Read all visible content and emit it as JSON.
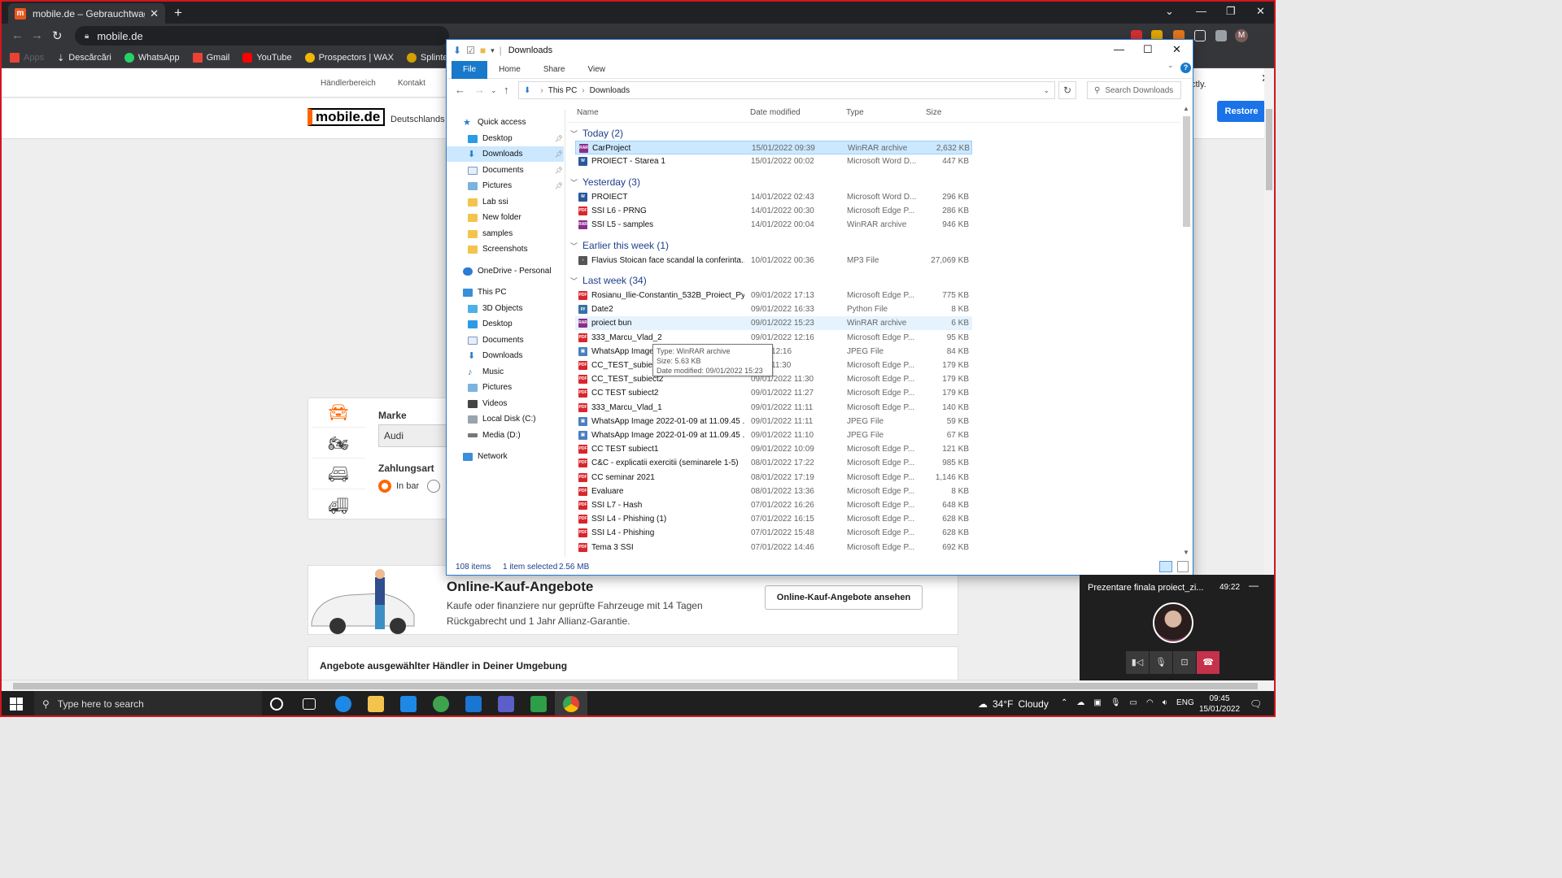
{
  "chrome": {
    "tab_title": "mobile.de – Gebrauchtwagen und",
    "url": "mobile.de",
    "bookmarks": [
      {
        "label": "Apps",
        "color": "#888888"
      },
      {
        "label": "Descărcări",
        "color": "#aaaaaa"
      },
      {
        "label": "WhatsApp",
        "color": "#25d366"
      },
      {
        "label": "Gmail",
        "color": "#ea4335"
      },
      {
        "label": "YouTube",
        "color": "#ff0000"
      },
      {
        "label": "Prospectors | WAX",
        "color": "#f2b705"
      },
      {
        "label": "Splinterlands",
        "color": "#d1a000"
      }
    ]
  },
  "site": {
    "nav": {
      "dealer_area": "Händlerbereich",
      "contact": "Kontakt"
    },
    "logo": "mobile.de",
    "tagline": "Deutschlands",
    "restore_text": "ctly.",
    "restore_button": "Restore",
    "search": {
      "brand_label": "Marke",
      "brand_value": "Audi",
      "payment_label": "Zahlungsart",
      "payment_cash": "In bar",
      "vehicle_icons": [
        "car-icon",
        "motorbike-icon",
        "camper-icon",
        "truck-icon"
      ]
    },
    "online": {
      "title": "Online-Kauf-Angebote",
      "description": "Kaufe oder finanziere nur geprüfte Fahrzeuge mit 14 Tagen Rückgabrecht und 1 Jahr Allianz-Garantie.",
      "button": "Online-Kauf-Angebote ansehen"
    },
    "dealers_title": "Angebote ausgewählter Händler in Deiner Umgebung"
  },
  "explorer": {
    "title": "Downloads",
    "ribbon_tabs": [
      "File",
      "Home",
      "Share",
      "View"
    ],
    "breadcrumb": [
      "This PC",
      "Downloads"
    ],
    "search_placeholder": "Search Downloads",
    "nav": {
      "quick_access": "Quick access",
      "quick_items": [
        "Desktop",
        "Downloads",
        "Documents",
        "Pictures",
        "Lab ssi",
        "New folder",
        "samples",
        "Screenshots"
      ],
      "onedrive": "OneDrive - Personal",
      "this_pc": "This PC",
      "pc_items": [
        "3D Objects",
        "Desktop",
        "Documents",
        "Downloads",
        "Music",
        "Pictures",
        "Videos",
        "Local Disk (C:)",
        "Media (D:)"
      ],
      "network": "Network"
    },
    "columns": {
      "name": "Name",
      "date": "Date modified",
      "type": "Type",
      "size": "Size"
    },
    "groups": [
      {
        "label": "Today (2)",
        "files": [
          {
            "name": "CarProject",
            "date": "15/01/2022 09:39",
            "type": "WinRAR archive",
            "size": "2,632 KB",
            "icon": "rar"
          },
          {
            "name": "PROIECT - Starea 1",
            "date": "15/01/2022 00:02",
            "type": "Microsoft Word D...",
            "size": "447 KB",
            "icon": "word"
          }
        ]
      },
      {
        "label": "Yesterday (3)",
        "files": [
          {
            "name": "PROIECT",
            "date": "14/01/2022 02:43",
            "type": "Microsoft Word D...",
            "size": "296 KB",
            "icon": "word"
          },
          {
            "name": "SSI L6 - PRNG",
            "date": "14/01/2022 00:30",
            "type": "Microsoft Edge P...",
            "size": "286 KB",
            "icon": "pdf"
          },
          {
            "name": "SSI L5 - samples",
            "date": "14/01/2022 00:04",
            "type": "WinRAR archive",
            "size": "946 KB",
            "icon": "rar"
          }
        ]
      },
      {
        "label": "Earlier this week (1)",
        "files": [
          {
            "name": "Flavius Stoican face scandal la conferinta...",
            "date": "10/01/2022 00:36",
            "type": "MP3 File",
            "size": "27,069 KB",
            "icon": "mp3"
          }
        ]
      },
      {
        "label": "Last week (34)",
        "files": [
          {
            "name": "Rosianu_Ilie-Constantin_532B_Proiect_Py...",
            "date": "09/01/2022 17:13",
            "type": "Microsoft Edge P...",
            "size": "775 KB",
            "icon": "pdf"
          },
          {
            "name": "Date2",
            "date": "09/01/2022 16:33",
            "type": "Python File",
            "size": "8 KB",
            "icon": "py"
          },
          {
            "name": "proiect bun",
            "date": "09/01/2022 15:23",
            "type": "WinRAR archive",
            "size": "6 KB",
            "icon": "rar"
          },
          {
            "name": "333_Marcu_Vlad_2",
            "date": "09/01/2022 12:16",
            "type": "Microsoft Edge P...",
            "size": "95 KB",
            "icon": "pdf"
          },
          {
            "name": "WhatsApp Image",
            "date": "2022 12:16",
            "type": "JPEG File",
            "size": "84 KB",
            "icon": "jpg"
          },
          {
            "name": "CC_TEST_subiect2",
            "date": "2022 11:30",
            "type": "Microsoft Edge P...",
            "size": "179 KB",
            "icon": "pdf"
          },
          {
            "name": "CC_TEST_subiect2",
            "date": "09/01/2022 11:30",
            "type": "Microsoft Edge P...",
            "size": "179 KB",
            "icon": "pdf"
          },
          {
            "name": "CC TEST subiect2",
            "date": "09/01/2022 11:27",
            "type": "Microsoft Edge P...",
            "size": "179 KB",
            "icon": "pdf"
          },
          {
            "name": "333_Marcu_Vlad_1",
            "date": "09/01/2022 11:11",
            "type": "Microsoft Edge P...",
            "size": "140 KB",
            "icon": "pdf"
          },
          {
            "name": "WhatsApp Image 2022-01-09 at 11.09.45 ...",
            "date": "09/01/2022 11:11",
            "type": "JPEG File",
            "size": "59 KB",
            "icon": "jpg"
          },
          {
            "name": "WhatsApp Image 2022-01-09 at 11.09.45 ...",
            "date": "09/01/2022 11:10",
            "type": "JPEG File",
            "size": "67 KB",
            "icon": "jpg"
          },
          {
            "name": "CC TEST subiect1",
            "date": "09/01/2022 10:09",
            "type": "Microsoft Edge P...",
            "size": "121 KB",
            "icon": "pdf"
          },
          {
            "name": "C&C - explicatii exercitii (seminarele 1-5)",
            "date": "08/01/2022 17:22",
            "type": "Microsoft Edge P...",
            "size": "985 KB",
            "icon": "pdf"
          },
          {
            "name": "CC seminar 2021",
            "date": "08/01/2022 17:19",
            "type": "Microsoft Edge P...",
            "size": "1,146 KB",
            "icon": "pdf"
          },
          {
            "name": "Evaluare",
            "date": "08/01/2022 13:36",
            "type": "Microsoft Edge P...",
            "size": "8 KB",
            "icon": "pdf"
          },
          {
            "name": "SSI L7 - Hash",
            "date": "07/01/2022 16:26",
            "type": "Microsoft Edge P...",
            "size": "648 KB",
            "icon": "pdf"
          },
          {
            "name": "SSI L4 - Phishing (1)",
            "date": "07/01/2022 16:15",
            "type": "Microsoft Edge P...",
            "size": "628 KB",
            "icon": "pdf"
          },
          {
            "name": "SSI L4 - Phishing",
            "date": "07/01/2022 15:48",
            "type": "Microsoft Edge P...",
            "size": "628 KB",
            "icon": "pdf"
          },
          {
            "name": "Tema 3 SSI",
            "date": "07/01/2022 14:46",
            "type": "Microsoft Edge P...",
            "size": "692 KB",
            "icon": "pdf"
          }
        ]
      }
    ],
    "tooltip": {
      "type": "Type: WinRAR archive",
      "size": "Size: 5.63 KB",
      "date": "Date modified: 09/01/2022 15:23"
    },
    "status": {
      "count": "108 items",
      "selected": "1 item selected",
      "size": "2.56 MB"
    }
  },
  "teams": {
    "title": "Prezentare finala proiect_zi...",
    "time": "49:22"
  },
  "taskbar": {
    "search_placeholder": "Type here to search",
    "temperature": "34°F",
    "weather": "Cloudy",
    "language": "ENG",
    "time": "09:45",
    "date": "15/01/2022"
  },
  "icon_colors": {
    "rar": "#8a2d8a",
    "word": "#2b579a",
    "pdf": "#d9262c",
    "mp3": "#555555",
    "py": "#3572a5",
    "jpg": "#4a7fc0"
  }
}
